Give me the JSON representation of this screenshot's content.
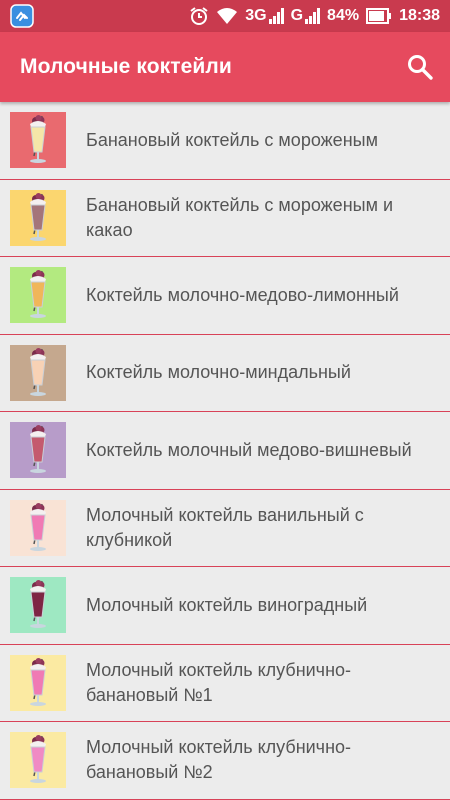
{
  "status_bar": {
    "network": "3G",
    "network2": "G",
    "battery_percent": "84%",
    "time": "18:38"
  },
  "app_bar": {
    "title": "Молочные коктейли",
    "search_icon": "search-icon"
  },
  "items": [
    {
      "label": "Банановый коктейль с мороженым",
      "bg": "#e96a6f",
      "drink": "#f5e6a8"
    },
    {
      "label": "Банановый коктейль с мороженым и какао",
      "bg": "#fbd66f",
      "drink": "#a4757a"
    },
    {
      "label": "Коктейль молочно-медово-лимонный",
      "bg": "#b3ea80",
      "drink": "#f0b65a"
    },
    {
      "label": "Коктейль молочно-миндальный",
      "bg": "#c5a88e",
      "drink": "#f8d2b5"
    },
    {
      "label": "Коктейль молочный медово-вишневый",
      "bg": "#b79cc9",
      "drink": "#c45a6e"
    },
    {
      "label": "Молочный коктейль ванильный с клубникой",
      "bg": "#f9e3d5",
      "drink": "#f07ab4"
    },
    {
      "label": "Молочный коктейль виноградный",
      "bg": "#9ee8c2",
      "drink": "#7e2544"
    },
    {
      "label": "Молочный коктейль клубнично-банановый №1",
      "bg": "#fbeaa2",
      "drink": "#f07ab4"
    },
    {
      "label": "Молочный коктейль клубнично-банановый №2",
      "bg": "#fbeaa2",
      "drink": "#f08ac4"
    }
  ]
}
